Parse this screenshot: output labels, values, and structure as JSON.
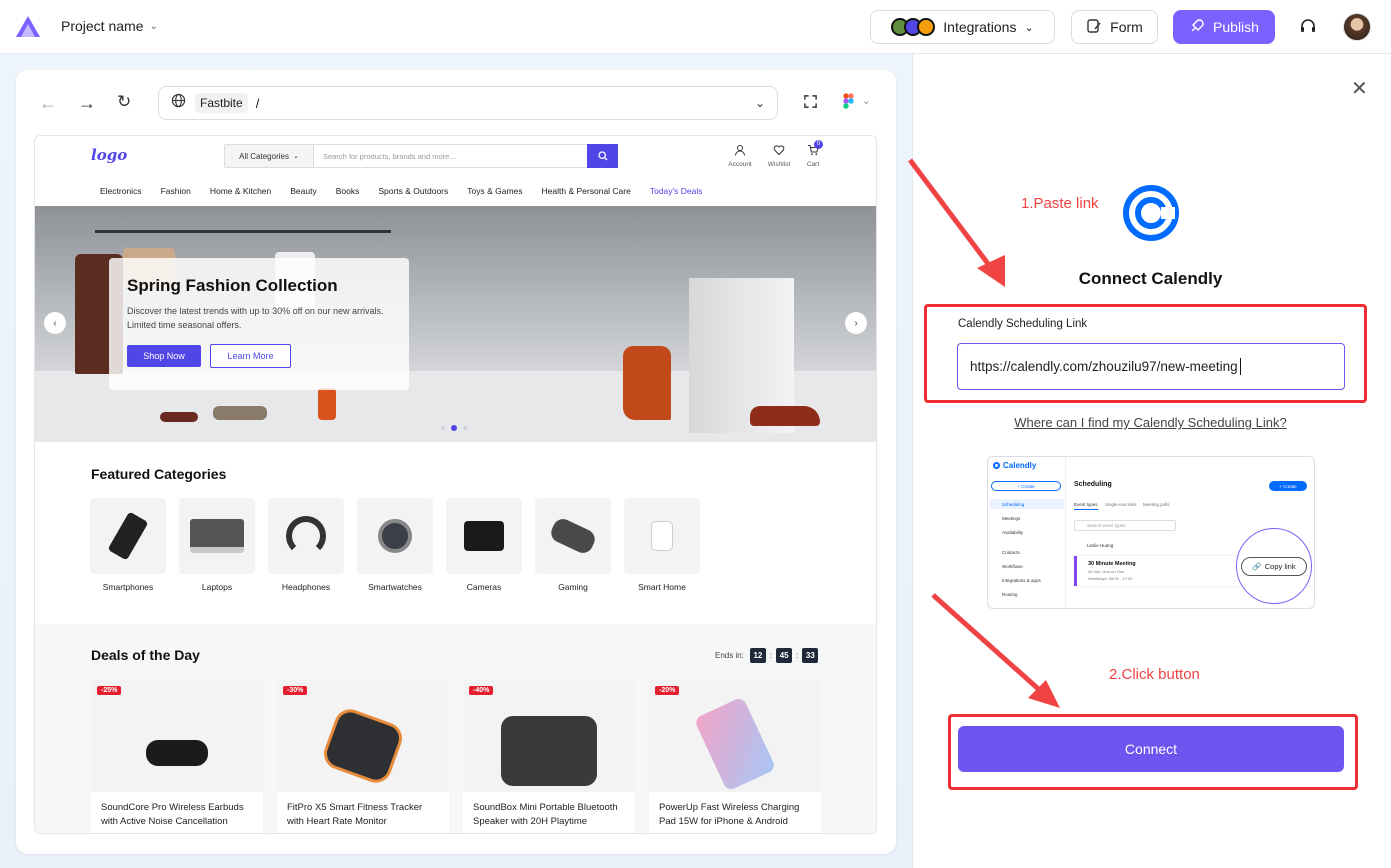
{
  "topbar": {
    "project_name": "Project name",
    "integrations_label": "Integrations",
    "form_label": "Form",
    "publish_label": "Publish",
    "accent": "#7b61ff"
  },
  "browser": {
    "site_name": "Fastbite",
    "path": "/"
  },
  "site": {
    "logo": "logo",
    "category_select": "All Categories",
    "search_placeholder": "Search for products, brands and more...",
    "account": "Account",
    "wishlist": "Wishlist",
    "cart": "Cart",
    "cart_count": "0",
    "nav": [
      "Electronics",
      "Fashion",
      "Home & Kitchen",
      "Beauty",
      "Books",
      "Sports & Outdoors",
      "Toys & Games",
      "Health & Personal Care",
      "Today's Deals"
    ],
    "hero": {
      "title": "Spring Fashion Collection",
      "subtitle": "Discover the latest trends with up to 30% off on our new arrivals. Limited time seasonal offers.",
      "shop_now": "Shop Now",
      "learn_more": "Learn More"
    },
    "featured_title": "Featured Categories",
    "categories": [
      "Smartphones",
      "Laptops",
      "Headphones",
      "Smartwatches",
      "Cameras",
      "Gaming",
      "Smart Home"
    ],
    "deals_title": "Deals of the Day",
    "ends_in": "Ends in:",
    "timer": [
      "12",
      "45",
      "33"
    ],
    "products": [
      {
        "badge": "-25%",
        "title": "SoundCore Pro Wireless Earbuds with Active Noise Cancellation"
      },
      {
        "badge": "-30%",
        "title": "FitPro X5 Smart Fitness Tracker with Heart Rate Monitor"
      },
      {
        "badge": "-40%",
        "title": "SoundBox Mini Portable Bluetooth Speaker with 20H Playtime"
      },
      {
        "badge": "-20%",
        "title": "PowerUp Fast Wireless Charging Pad 15W for iPhone & Android"
      }
    ]
  },
  "panel": {
    "step1": "1.Paste link",
    "step2": "2.Click button",
    "title": "Connect Calendly",
    "field_label": "Calendly Scheduling Link",
    "field_value": "https://calendly.com/zhouzilu97/new-meeting",
    "help_link": "Where can I find my Calendly Scheduling Link?",
    "connect_label": "Connect",
    "preview": {
      "brand": "Calendly",
      "create": "+ Create",
      "scheduling": "Scheduling",
      "menu": [
        "Scheduling",
        "Meetings",
        "Availability",
        "Contacts",
        "Workflows",
        "Integrations & apps",
        "Routing"
      ],
      "tabs": [
        "Event types",
        "Single-use links",
        "Meeting polls"
      ],
      "search": "Search event types",
      "user": "Leslie Huang",
      "event": "30 Minute Meeting",
      "event_sub": "30 min, One-on-One",
      "event_sub2": "Weekdays, 09:00 - 17:00",
      "copy_link": "Copy link",
      "create_btn": "+ Create"
    }
  }
}
